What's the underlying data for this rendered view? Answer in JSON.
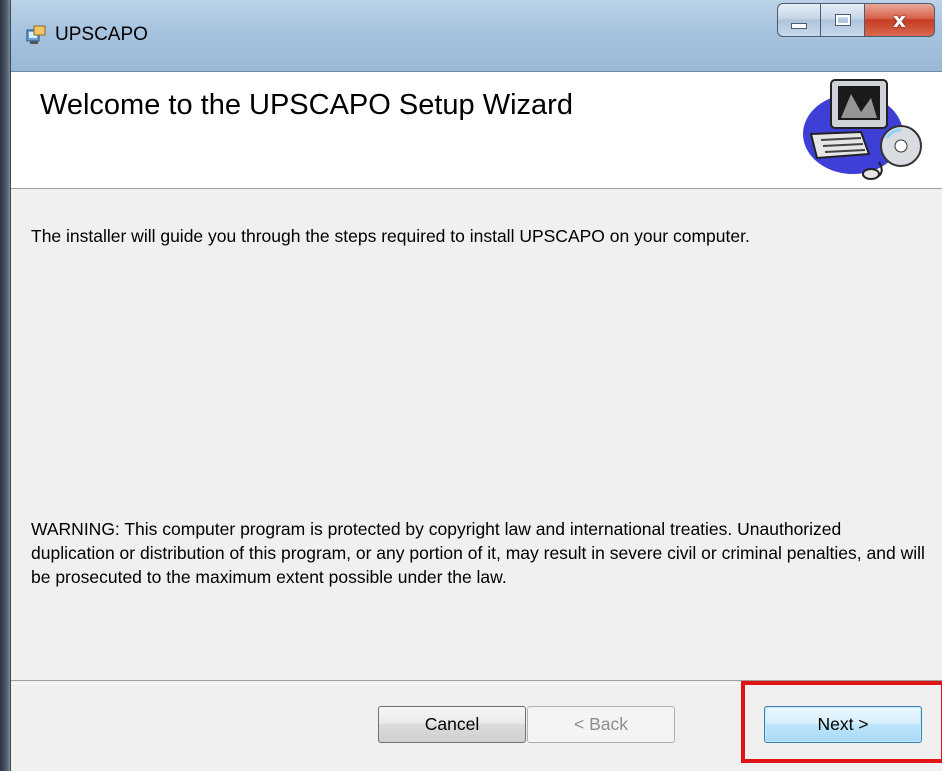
{
  "window": {
    "title": "UPSCAPO",
    "close_glyph": "x"
  },
  "header": {
    "title": "Welcome to the UPSCAPO Setup Wizard",
    "graphic_icon": "computer-setup-graphic"
  },
  "body": {
    "intro": "The installer will guide you through the steps required to install UPSCAPO on your computer.",
    "warning": "WARNING: This computer program is protected by copyright law and international treaties. Unauthorized duplication or distribution of this program, or any portion of it, may result in severe civil or criminal penalties, and will be prosecuted to the maximum extent possible under the law."
  },
  "buttons": {
    "cancel": "Cancel",
    "back": "< Back",
    "next": "Next >"
  },
  "colors": {
    "highlight": "#e01414",
    "titlebar": "#a8c4df",
    "close": "#c43d22"
  }
}
